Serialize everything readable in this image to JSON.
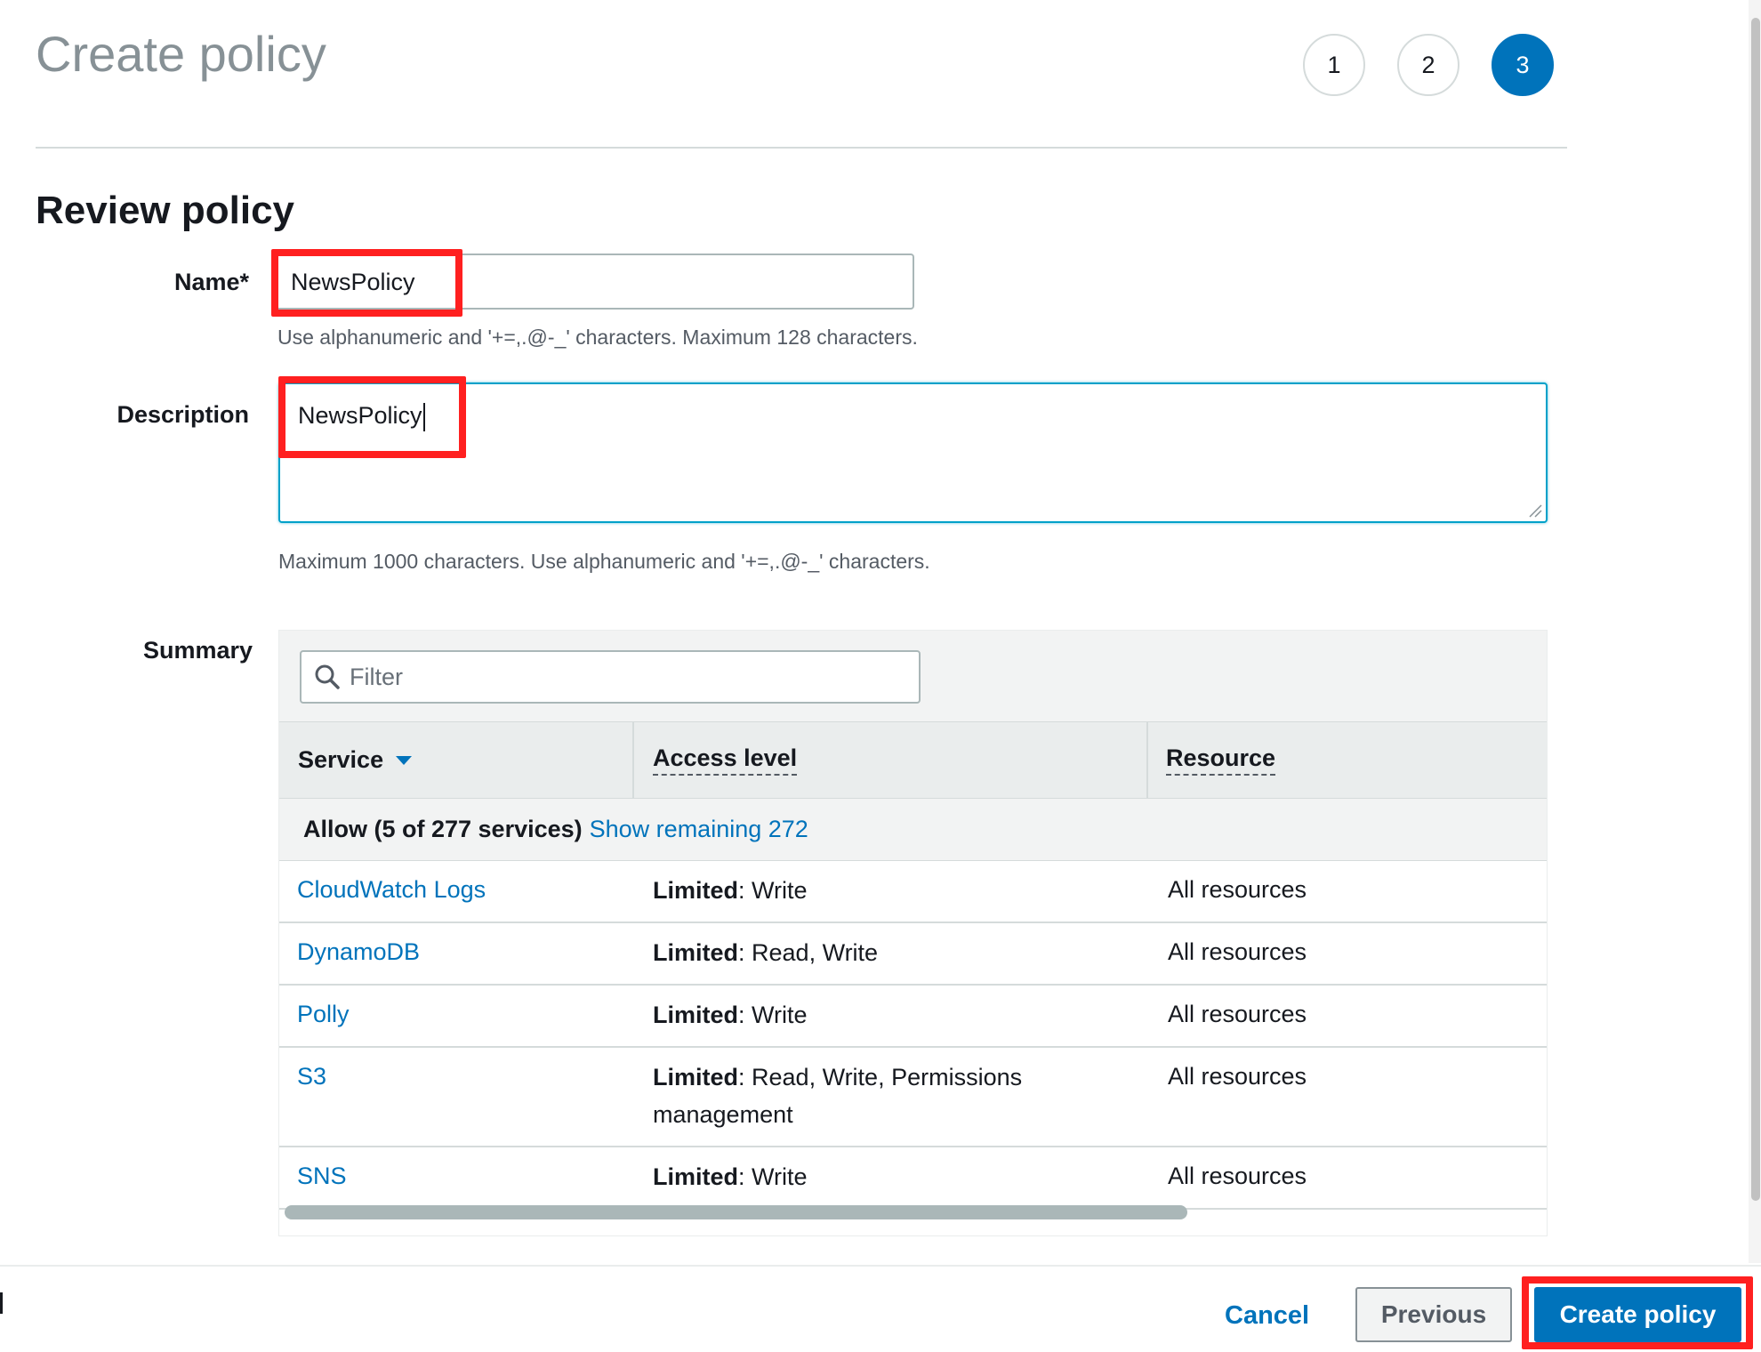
{
  "header": {
    "title": "Create policy",
    "steps": [
      "1",
      "2",
      "3"
    ],
    "active_step": "3"
  },
  "section": {
    "title": "Review policy"
  },
  "form": {
    "name_label": "Name*",
    "name_value": "NewsPolicy",
    "name_hint": "Use alphanumeric and '+=,.@-_' characters. Maximum 128 characters.",
    "description_label": "Description",
    "description_value": "NewsPolicy",
    "description_hint": "Maximum 1000 characters. Use alphanumeric and '+=,.@-_' characters.",
    "summary_label": "Summary"
  },
  "summary": {
    "filter_placeholder": "Filter",
    "columns": [
      "Service",
      "Access level",
      "Resource"
    ],
    "group_label": "Allow (5 of 277 services)",
    "group_link": "Show remaining 272",
    "rows": [
      {
        "service": "CloudWatch Logs",
        "access_level": "Limited",
        "access_detail": ": Write",
        "resource": "All resources"
      },
      {
        "service": "DynamoDB",
        "access_level": "Limited",
        "access_detail": ": Read, Write",
        "resource": "All resources"
      },
      {
        "service": "Polly",
        "access_level": "Limited",
        "access_detail": ": Write",
        "resource": "All resources"
      },
      {
        "service": "S3",
        "access_level": "Limited",
        "access_detail": ": Read, Write, Permissions management",
        "resource": "All resources"
      },
      {
        "service": "SNS",
        "access_level": "Limited",
        "access_detail": ": Write",
        "resource": "All resources"
      }
    ]
  },
  "footer": {
    "cancel_label": "Cancel",
    "previous_label": "Previous",
    "create_label": "Create policy"
  },
  "colors": {
    "accent": "#0073bb",
    "highlight": "#ff2020",
    "title_gray": "#879196"
  },
  "icons": [
    "search-icon",
    "sort-caret-icon",
    "resize-grip-icon"
  ]
}
